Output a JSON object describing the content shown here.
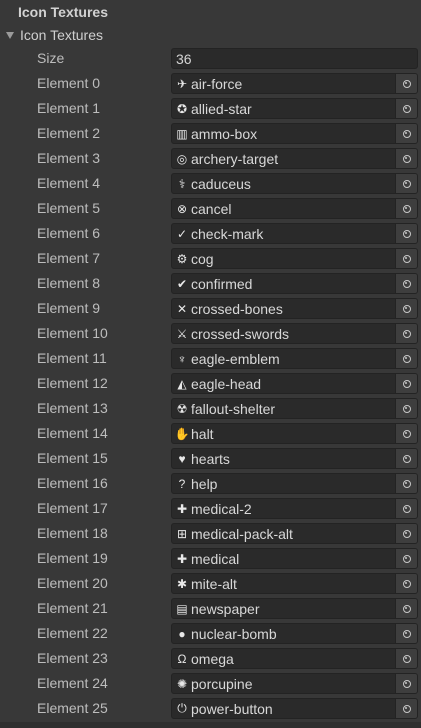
{
  "header": {
    "title": "Icon Textures"
  },
  "foldout": {
    "label": "Icon Textures"
  },
  "size": {
    "label": "Size",
    "value": "36"
  },
  "elements": [
    {
      "label": "Element 0",
      "name": "air-force",
      "icon": "✈"
    },
    {
      "label": "Element 1",
      "name": "allied-star",
      "icon": "✪"
    },
    {
      "label": "Element 2",
      "name": "ammo-box",
      "icon": "▥"
    },
    {
      "label": "Element 3",
      "name": "archery-target",
      "icon": "◎"
    },
    {
      "label": "Element 4",
      "name": "caduceus",
      "icon": "⚕"
    },
    {
      "label": "Element 5",
      "name": "cancel",
      "icon": "⊗"
    },
    {
      "label": "Element 6",
      "name": "check-mark",
      "icon": "✓"
    },
    {
      "label": "Element 7",
      "name": "cog",
      "icon": "⚙"
    },
    {
      "label": "Element 8",
      "name": "confirmed",
      "icon": "✔"
    },
    {
      "label": "Element 9",
      "name": "crossed-bones",
      "icon": "✕"
    },
    {
      "label": "Element 10",
      "name": "crossed-swords",
      "icon": "⚔"
    },
    {
      "label": "Element 11",
      "name": "eagle-emblem",
      "icon": "♆"
    },
    {
      "label": "Element 12",
      "name": "eagle-head",
      "icon": "◭"
    },
    {
      "label": "Element 13",
      "name": "fallout-shelter",
      "icon": "☢"
    },
    {
      "label": "Element 14",
      "name": "halt",
      "icon": "✋"
    },
    {
      "label": "Element 15",
      "name": "hearts",
      "icon": "♥"
    },
    {
      "label": "Element 16",
      "name": "help",
      "icon": "?"
    },
    {
      "label": "Element 17",
      "name": "medical-2",
      "icon": "✚"
    },
    {
      "label": "Element 18",
      "name": "medical-pack-alt",
      "icon": "⊞"
    },
    {
      "label": "Element 19",
      "name": "medical",
      "icon": "✚"
    },
    {
      "label": "Element 20",
      "name": "mite-alt",
      "icon": "✱"
    },
    {
      "label": "Element 21",
      "name": "newspaper",
      "icon": "▤"
    },
    {
      "label": "Element 22",
      "name": "nuclear-bomb",
      "icon": "●"
    },
    {
      "label": "Element 23",
      "name": "omega",
      "icon": "Ω"
    },
    {
      "label": "Element 24",
      "name": "porcupine",
      "icon": "✺"
    },
    {
      "label": "Element 25",
      "name": "power-button",
      "icon": "⏻"
    }
  ]
}
